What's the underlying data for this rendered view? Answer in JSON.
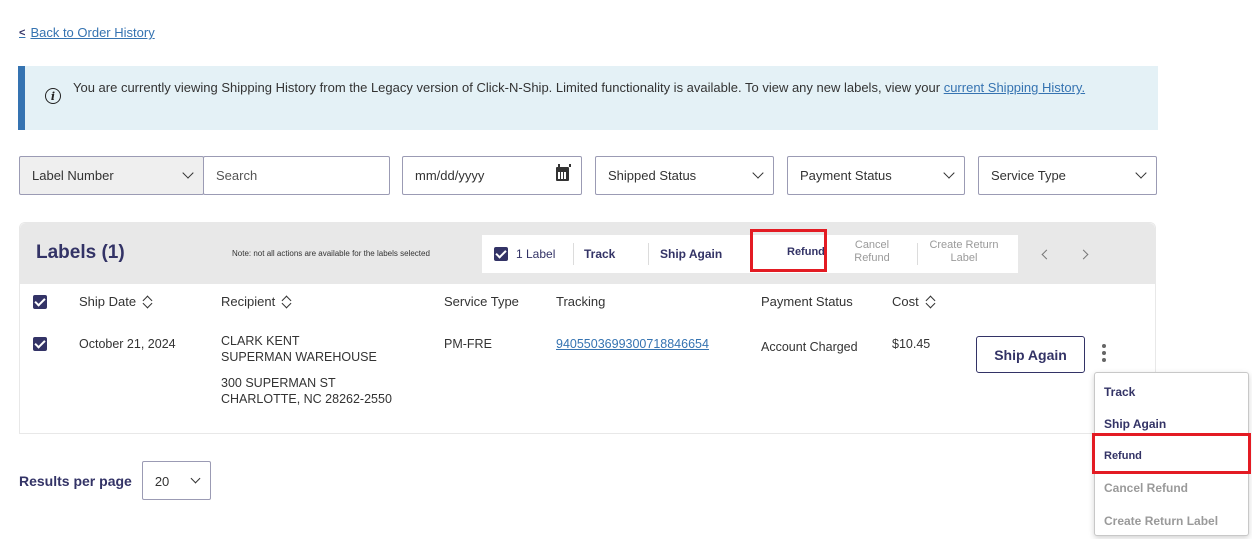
{
  "back_link": "Back to Order History",
  "banner": {
    "text": "You are currently viewing Shipping History from the Legacy version of Click-N-Ship. Limited functionality is available. To view any new labels, view your",
    "link": "current Shipping History."
  },
  "filters": {
    "label_number": "Label Number",
    "search_placeholder": "Search",
    "date_placeholder": "mm/dd/yyyy",
    "shipped_status": "Shipped Status",
    "payment_status": "Payment Status",
    "service_type": "Service Type"
  },
  "labels_panel": {
    "title": "Labels (1)",
    "note": "Note: not all actions are available for the labels selected",
    "selected_count": "1 Label",
    "actions": {
      "track": "Track",
      "ship_again": "Ship Again",
      "refund": "Refund",
      "cancel_refund_1": "Cancel",
      "cancel_refund_2": "Refund",
      "create_return_1": "Create Return",
      "create_return_2": "Label"
    }
  },
  "columns": {
    "ship_date": "Ship Date",
    "recipient": "Recipient",
    "service_type": "Service Type",
    "tracking": "Tracking",
    "payment_status": "Payment Status",
    "cost": "Cost"
  },
  "row": {
    "ship_date": "October 21, 2024",
    "recipient_name": "CLARK KENT",
    "recipient_company": "SUPERMAN WAREHOUSE",
    "address_line1": "300 SUPERMAN ST",
    "address_line2": "CHARLOTTE, NC 28262-2550",
    "service_type": "PM-FRE",
    "tracking": "9405503699300718846654",
    "payment_status": "Account Charged",
    "cost": "$10.45",
    "ship_again_button": "Ship Again"
  },
  "results_per_page": {
    "label": "Results per page",
    "value": "20"
  },
  "row_menu": {
    "items": [
      "Track",
      "Ship Again",
      "Refund",
      "Cancel Refund",
      "Create Return Label"
    ],
    "disabled": [
      "Cancel Refund",
      "Create Return Label"
    ]
  },
  "colors": {
    "navy": "#333366",
    "link_blue": "#3573b1",
    "banner_bg": "#e4f1f6",
    "highlight_red": "#e31b23"
  }
}
